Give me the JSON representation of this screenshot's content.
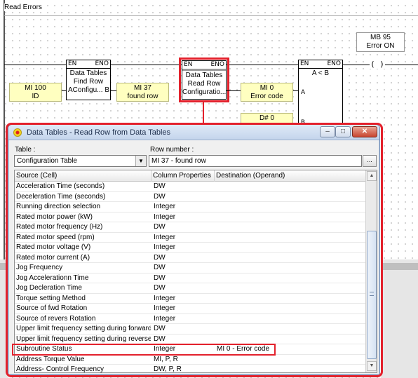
{
  "network": {
    "title": "Read Errors"
  },
  "ladder": {
    "fb1": {
      "en": "EN",
      "eno": "ENO",
      "lines": [
        "Data Tables",
        "Find Row"
      ],
      "bottom": "AConfigu...",
      "out_pin": "B"
    },
    "op_mi100": {
      "line1": "MI 100",
      "line2": "ID"
    },
    "op_mi37": {
      "line1": "MI 37",
      "line2": "found row"
    },
    "fb2": {
      "en": "EN",
      "eno": "ENO",
      "lines": [
        "Data Tables",
        "Read Row",
        "Configuratio..."
      ]
    },
    "op_mi0": {
      "line1": "MI 0",
      "line2": "Error code"
    },
    "op_d0": {
      "line1": "D# 0"
    },
    "fb3": {
      "en": "EN",
      "eno": "ENO",
      "lines": [
        "A < B"
      ],
      "pin_a": "A",
      "pin_b": "B"
    },
    "coil_label": {
      "line1": "MB 95",
      "line2": "Error ON"
    },
    "coil_symbol": "( )"
  },
  "dialog": {
    "title": "Data Tables - Read Row from Data Tables",
    "buttons": {
      "minimize": "–",
      "maximize": "□",
      "close": "✕"
    },
    "table_label": "Table :",
    "table_value": "Configuration Table",
    "row_label": "Row number :",
    "row_value": "MI 37  - found row",
    "browse_label": "...",
    "columns": [
      "Source (Cell)",
      "Column Properties",
      "Destination (Operand)"
    ],
    "rows": [
      [
        "Acceleration Time (seconds)",
        "DW",
        ""
      ],
      [
        "Deceleration Time (seconds)",
        "DW",
        ""
      ],
      [
        "Running direction selection",
        "Integer",
        ""
      ],
      [
        "Rated motor power (kW)",
        "Integer",
        ""
      ],
      [
        "Rated motor frequency (Hz)",
        "DW",
        ""
      ],
      [
        "Rated motor speed (rpm)",
        "Integer",
        ""
      ],
      [
        "Rated motor voltage (V)",
        "Integer",
        ""
      ],
      [
        "Rated motor current (A)",
        "DW",
        ""
      ],
      [
        "Jog Frequency",
        "DW",
        ""
      ],
      [
        "Jog Accelerationn Time",
        "DW",
        ""
      ],
      [
        "Jog Decleration Time",
        "DW",
        ""
      ],
      [
        "Torque setting Method",
        "Integer",
        ""
      ],
      [
        "Source of fwd Rotation",
        "Integer",
        ""
      ],
      [
        "Source of revers Rotation",
        "Integer",
        ""
      ],
      [
        "Upper limit frequency setting during forward",
        "DW",
        ""
      ],
      [
        "Upper limit frequency setting during reverse",
        "DW",
        ""
      ],
      [
        "Subroutine Status",
        "Integer",
        "MI 0  - Error code"
      ],
      [
        "Address Torque Value",
        "MI, P, R",
        ""
      ],
      [
        "Address- Control Frequency",
        "DW, P, R",
        ""
      ]
    ],
    "highlighted_row": 16
  },
  "colors": {
    "accent_red": "#e3212c",
    "operand_fill": "#ffffc0"
  }
}
